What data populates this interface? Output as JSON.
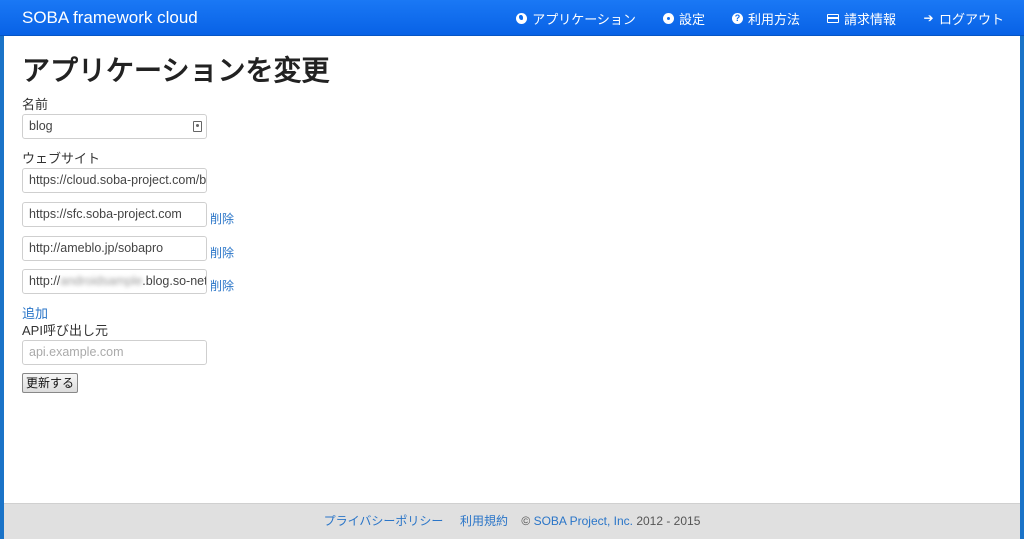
{
  "nav": {
    "brand": "SOBA framework cloud",
    "items": [
      {
        "label": "アプリケーション",
        "icon": "globe-icon"
      },
      {
        "label": "設定",
        "icon": "gear-icon"
      },
      {
        "label": "利用方法",
        "icon": "help-icon"
      },
      {
        "label": "請求情報",
        "icon": "credit-card-icon"
      },
      {
        "label": "ログアウト",
        "icon": "arrow-right-icon"
      }
    ]
  },
  "page": {
    "title": "アプリケーションを変更"
  },
  "form": {
    "name_label": "名前",
    "name_value": "blog",
    "website_label": "ウェブサイト",
    "websites": [
      "https://cloud.soba-project.com/bl",
      "https://sfc.soba-project.com",
      "http://ameblo.jp/sobapro"
    ],
    "website4_prefix": "http://",
    "website4_blurred": "androidsample",
    "website4_suffix": ".blog.so-net",
    "delete_label": "削除",
    "add_label": "追加",
    "api_label": "API呼び出し元",
    "api_placeholder": "api.example.com",
    "submit_label": "更新する"
  },
  "footer": {
    "privacy": "プライバシーポリシー",
    "terms": "利用規約",
    "copyright_symbol": "©",
    "company": "SOBA Project, Inc.",
    "years": "2012 - 2015"
  },
  "colors": {
    "navbar": "#0a6cf2",
    "link": "#2a75c8",
    "footer_bg": "#e0e0e0"
  }
}
